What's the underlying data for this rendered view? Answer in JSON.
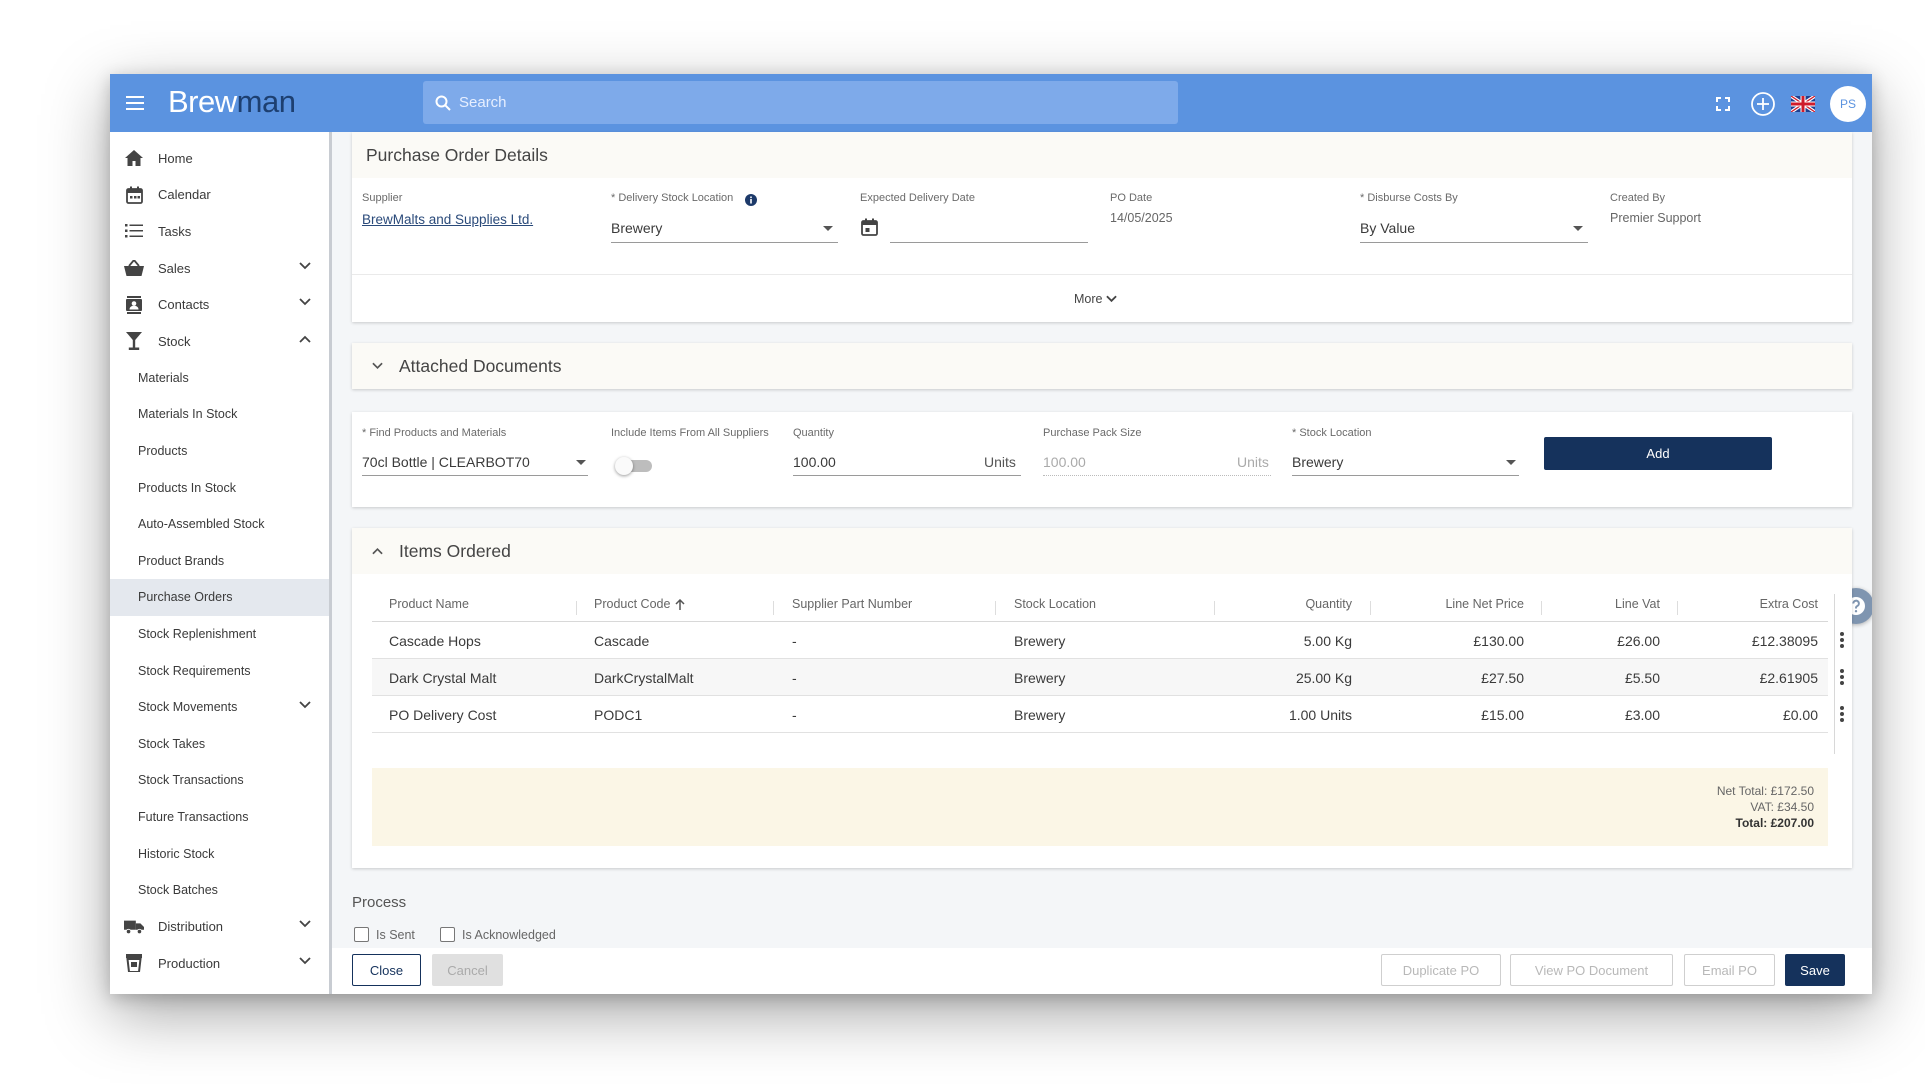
{
  "app": {
    "logo_part1": "Brew",
    "logo_part2": "man"
  },
  "header": {
    "search_placeholder": "Search",
    "avatar_initials": "PS"
  },
  "sidebar": {
    "items": [
      {
        "label": "Home",
        "icon": "home-icon"
      },
      {
        "label": "Calendar",
        "icon": "calendar-icon"
      },
      {
        "label": "Tasks",
        "icon": "list-icon"
      },
      {
        "label": "Sales",
        "icon": "basket-icon",
        "expand": "down"
      },
      {
        "label": "Contacts",
        "icon": "contacts-icon",
        "expand": "down"
      },
      {
        "label": "Stock",
        "icon": "glass-icon",
        "expand": "up"
      },
      {
        "label": "Materials"
      },
      {
        "label": "Materials In Stock"
      },
      {
        "label": "Products"
      },
      {
        "label": "Products In Stock"
      },
      {
        "label": "Auto-Assembled Stock"
      },
      {
        "label": "Product Brands"
      },
      {
        "label": "Purchase Orders",
        "active": true
      },
      {
        "label": "Stock Replenishment"
      },
      {
        "label": "Stock Requirements"
      },
      {
        "label": "Stock Movements",
        "expand": "down"
      },
      {
        "label": "Stock Takes"
      },
      {
        "label": "Stock Transactions"
      },
      {
        "label": "Future Transactions"
      },
      {
        "label": "Historic Stock"
      },
      {
        "label": "Stock Batches"
      },
      {
        "label": "Distribution",
        "icon": "truck-icon",
        "expand": "down"
      },
      {
        "label": "Production",
        "icon": "production-icon",
        "expand": "down"
      }
    ]
  },
  "po_details": {
    "title": "Purchase Order Details",
    "supplier_label": "Supplier",
    "supplier_value": "BrewMalts and Supplies Ltd.",
    "delivery_location_label": "* Delivery Stock Location",
    "delivery_location_value": "Brewery",
    "expected_date_label": "Expected Delivery Date",
    "expected_date_value": "",
    "po_date_label": "PO Date",
    "po_date_value": "14/05/2025",
    "disburse_label": "* Disburse Costs By",
    "disburse_value": "By Value",
    "created_by_label": "Created By",
    "created_by_value": "Premier Support",
    "more_label": "More"
  },
  "attached": {
    "title": "Attached Documents"
  },
  "add_items": {
    "find_label": "* Find Products and Materials",
    "find_value": "70cl Bottle | CLEARBOT70",
    "include_label": "Include Items From All Suppliers",
    "quantity_label": "Quantity",
    "quantity_value": "100.00",
    "quantity_unit": "Units",
    "pack_label": "Purchase Pack Size",
    "pack_value": "100.00",
    "pack_unit": "Units",
    "location_label": "* Stock Location",
    "location_value": "Brewery",
    "add_button": "Add"
  },
  "items": {
    "title": "Items Ordered",
    "columns": [
      "Product Name",
      "Product Code",
      "Supplier Part Number",
      "Stock Location",
      "Quantity",
      "Line Net Price",
      "Line Vat",
      "Extra Cost"
    ],
    "rows": [
      [
        "Cascade Hops",
        "Cascade",
        "-",
        "Brewery",
        "5.00 Kg",
        "£130.00",
        "£26.00",
        "£12.38095"
      ],
      [
        "Dark Crystal Malt",
        "DarkCrystalMalt",
        "-",
        "Brewery",
        "25.00 Kg",
        "£27.50",
        "£5.50",
        "£2.61905"
      ],
      [
        "PO Delivery Cost",
        "PODC1",
        "-",
        "Brewery",
        "1.00 Units",
        "£15.00",
        "£3.00",
        "£0.00"
      ]
    ],
    "net_total": "Net Total: £172.50",
    "vat_total": "VAT: £34.50",
    "grand_total": "Total: £207.00"
  },
  "process": {
    "title": "Process",
    "is_sent": "Is Sent",
    "is_acknowledged": "Is Acknowledged"
  },
  "footer": {
    "close": "Close",
    "cancel": "Cancel",
    "duplicate": "Duplicate PO",
    "view_doc": "View PO Document",
    "email": "Email PO",
    "save": "Save"
  },
  "colors": {
    "header": "#5b93e0",
    "primary": "#15325c",
    "totals_bg": "#fbf6e6"
  }
}
